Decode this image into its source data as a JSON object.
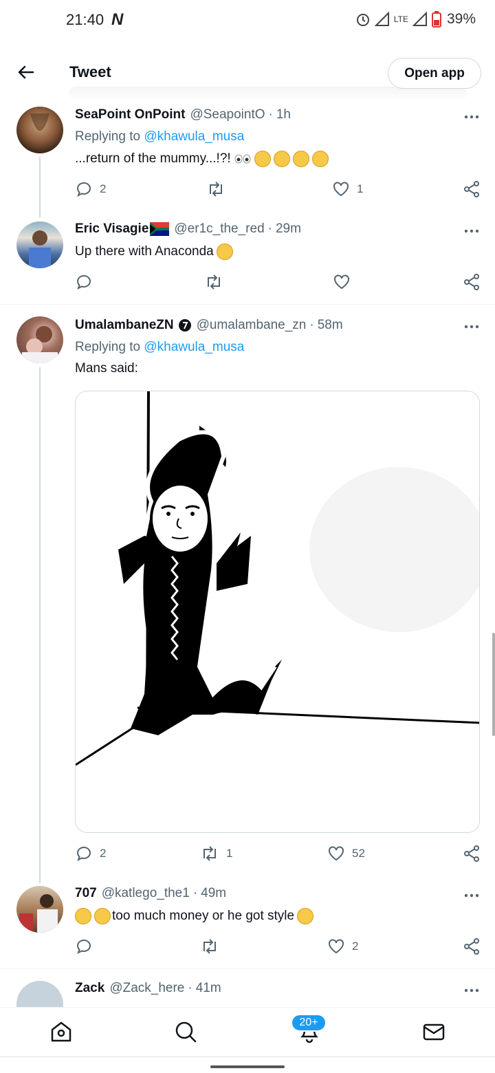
{
  "status_bar": {
    "time": "21:40",
    "battery": "39%",
    "network": "LTE"
  },
  "header": {
    "title": "Tweet",
    "open_app": "Open app"
  },
  "tweets": [
    {
      "name": "SeaPoint OnPoint",
      "handle": "@SeapointO",
      "time": "1h",
      "replying_prefix": "Replying to",
      "replying_to": "@khawula_musa",
      "text": "...return of the mummy...!?!",
      "replies": "2",
      "retweets": "",
      "likes": "1"
    },
    {
      "name": "Eric Visagie",
      "handle": "@er1c_the_red",
      "time": "29m",
      "text": "Up there with Anaconda",
      "replies": "",
      "retweets": "",
      "likes": ""
    },
    {
      "name": "UmalambaneZN",
      "handle": "@umalambane_zn",
      "time": "58m",
      "replying_prefix": "Replying to",
      "replying_to": "@khawula_musa",
      "text": "Mans said:",
      "replies": "2",
      "retweets": "1",
      "likes": "52"
    },
    {
      "name": "707",
      "handle": "@katlego_the1",
      "time": "49m",
      "text": "too much money or he got style",
      "replies": "",
      "retweets": "",
      "likes": "2"
    },
    {
      "name": "Zack",
      "handle": "@Zack_here",
      "time": "41m"
    }
  ],
  "bottom_nav": {
    "notifications_badge": "20+"
  },
  "colors": {
    "accent": "#1d9bf0",
    "text": "#0f1419",
    "muted": "#536471",
    "border": "#cfd9de"
  }
}
